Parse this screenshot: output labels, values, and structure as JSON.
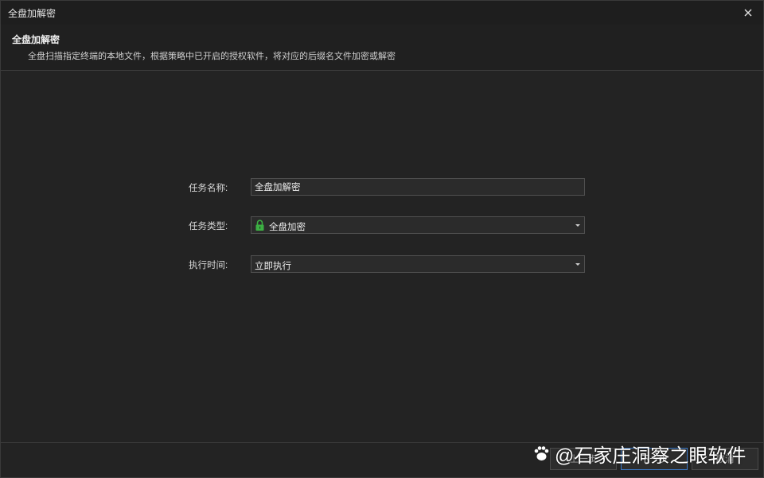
{
  "window": {
    "title": "全盘加解密"
  },
  "header": {
    "title": "全盘加解密",
    "description": "全盘扫描指定终端的本地文件，根据策略中已开启的授权软件，将对应的后缀名文件加密或解密"
  },
  "form": {
    "task_name": {
      "label": "任务名称:",
      "value": "全盘加解密"
    },
    "task_type": {
      "label": "任务类型:",
      "value": "全盘加密",
      "icon": "lock-icon"
    },
    "exec_time": {
      "label": "执行时间:",
      "value": "立即执行"
    }
  },
  "footer": {
    "prev_label": "上一步",
    "next_label": "下一步",
    "cancel_label": "取消"
  },
  "watermark": {
    "text": "@石家庄洞察之眼软件"
  },
  "colors": {
    "background": "#232323",
    "lock_green": "#3cb043",
    "primary_border": "#3a78c8"
  }
}
